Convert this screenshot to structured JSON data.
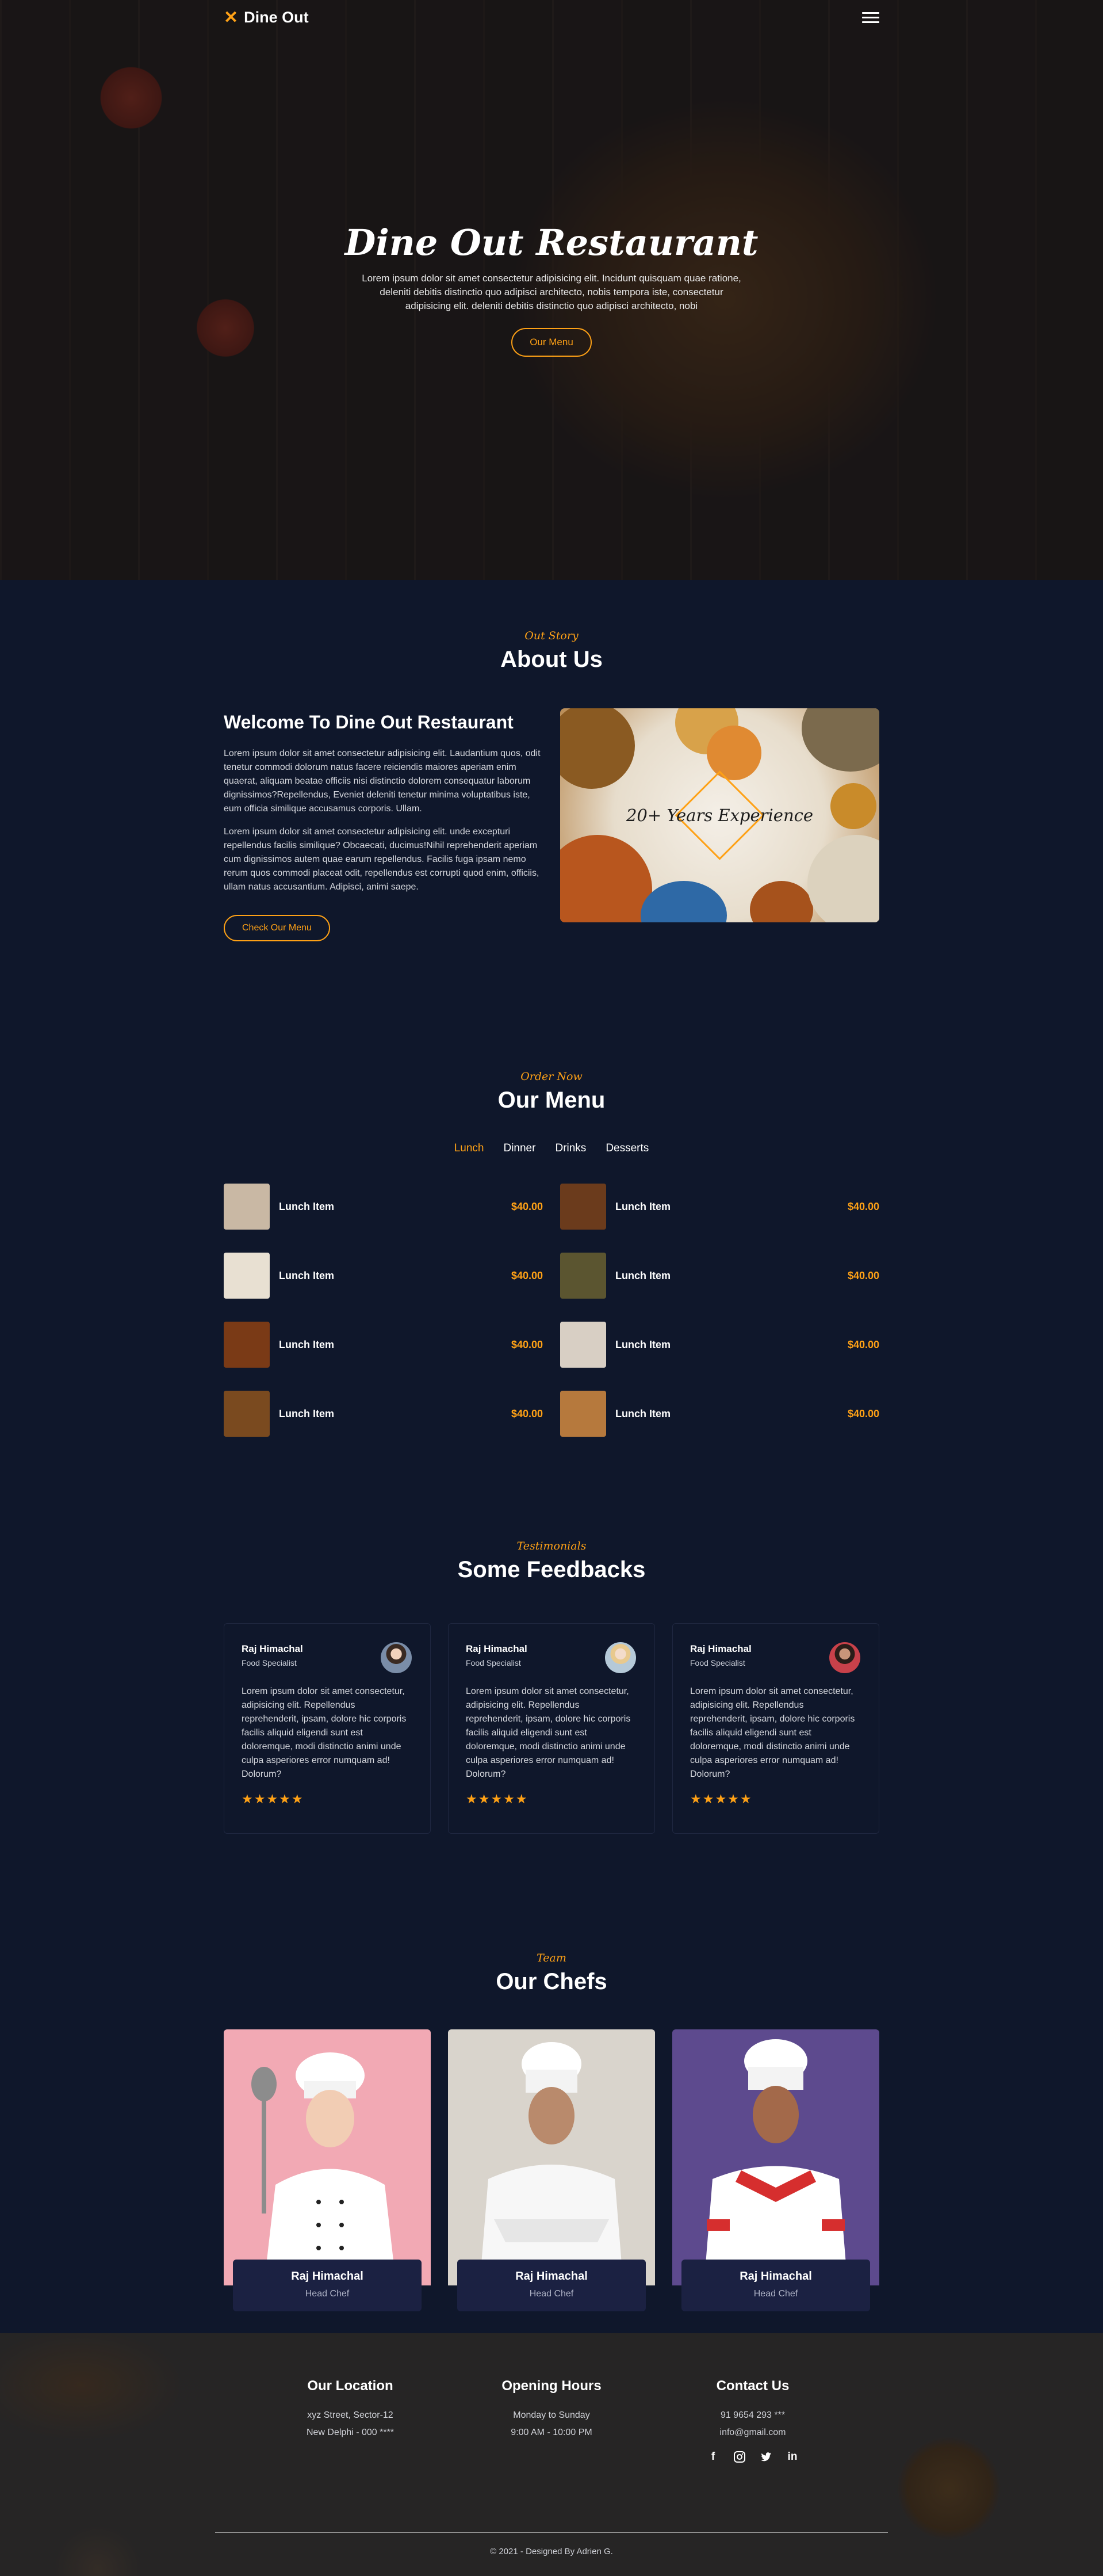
{
  "nav": {
    "brand": "Dine Out",
    "brand_icon": "utensils-icon"
  },
  "hero": {
    "title": "Dine Out Restaurant",
    "subtitle": "Lorem ipsum dolor sit amet consectetur adipisicing elit. Incidunt quisquam quae ratione, deleniti debitis distinctio quo adipisci architecto, nobis tempora iste, consectetur adipisicing elit. deleniti debitis distinctio quo adipisci architecto, nobi",
    "button": "Our Menu"
  },
  "about": {
    "label": "Out Story",
    "title": "About Us",
    "heading": "Welcome To Dine Out Restaurant",
    "para1": "Lorem ipsum dolor sit amet consectetur adipisicing elit. Laudantium quos, odit tenetur commodi dolorum natus facere reiciendis maiores aperiam enim quaerat, aliquam beatae officiis nisi distinctio dolorem consequatur laborum dignissimos?Repellendus, Eveniet deleniti tenetur minima voluptatibus iste, eum officia similique accusamus corporis. Ullam.",
    "para2": "Lorem ipsum dolor sit amet consectetur adipisicing elit. unde excepturi repellendus facilis similique? Obcaecati, ducimus!Nihil reprehenderit aperiam cum dignissimos autem quae earum repellendus. Facilis fuga ipsam nemo rerum quos commodi placeat odit, repellendus est corrupti quod enim, officiis, ullam natus accusantium. Adipisci, animi saepe.",
    "button": "Check Our Menu",
    "badge": "20+ Years Experience"
  },
  "menu": {
    "label": "Order Now",
    "title": "Our Menu",
    "tabs": [
      "Lunch",
      "Dinner",
      "Drinks",
      "Desserts"
    ],
    "active_tab": "Lunch",
    "items": [
      {
        "name": "Lunch Item",
        "price": "$40.00",
        "color": "#c9b8a4"
      },
      {
        "name": "Lunch Item",
        "price": "$40.00",
        "color": "#6b3b1c"
      },
      {
        "name": "Lunch Item",
        "price": "$40.00",
        "color": "#e8e0d2"
      },
      {
        "name": "Lunch Item",
        "price": "$40.00",
        "color": "#5b5530"
      },
      {
        "name": "Lunch Item",
        "price": "$40.00",
        "color": "#7a3a16"
      },
      {
        "name": "Lunch Item",
        "price": "$40.00",
        "color": "#d8cfc4"
      },
      {
        "name": "Lunch Item",
        "price": "$40.00",
        "color": "#7a4a1f"
      },
      {
        "name": "Lunch Item",
        "price": "$40.00",
        "color": "#b6793d"
      }
    ]
  },
  "feedback": {
    "label": "Testimonials",
    "title": "Some Feedbacks",
    "cards": [
      {
        "name": "Raj Himachal",
        "role": "Food Specialist",
        "text": "Lorem ipsum dolor sit amet consectetur, adipisicing elit. Repellendus reprehenderit, ipsam, dolore hic corporis facilis aliquid eligendi sunt est doloremque, modi distinctio animi unde culpa asperiores error numquam ad! Dolorum?",
        "stars": "★★★★★",
        "avatar_color": "#7a8da8"
      },
      {
        "name": "Raj Himachal",
        "role": "Food Specialist",
        "text": "Lorem ipsum dolor sit amet consectetur, adipisicing elit. Repellendus reprehenderit, ipsam, dolore hic corporis facilis aliquid eligendi sunt est doloremque, modi distinctio animi unde culpa asperiores error numquam ad! Dolorum?",
        "stars": "★★★★★",
        "avatar_color": "#b5c9d8"
      },
      {
        "name": "Raj Himachal",
        "role": "Food Specialist",
        "text": "Lorem ipsum dolor sit amet consectetur, adipisicing elit. Repellendus reprehenderit, ipsam, dolore hic corporis facilis aliquid eligendi sunt est doloremque, modi distinctio animi unde culpa asperiores error numquam ad! Dolorum?",
        "stars": "★★★★★",
        "avatar_color": "#c8414a"
      }
    ]
  },
  "chefs": {
    "label": "Team",
    "title": "Our Chefs",
    "items": [
      {
        "name": "Raj Himachal",
        "role": "Head Chef",
        "bg": "#f2a9b4"
      },
      {
        "name": "Raj Himachal",
        "role": "Head Chef",
        "bg": "#d9d4cc"
      },
      {
        "name": "Raj Himachal",
        "role": "Head Chef",
        "bg": "#5d4a8e"
      }
    ]
  },
  "footer": {
    "location": {
      "title": "Our Location",
      "line1": "xyz Street, Sector-12",
      "line2": "New Delphi - 000 ****"
    },
    "hours": {
      "title": "Opening Hours",
      "line1": "Monday to Sunday",
      "line2": "9:00 AM - 10:00 PM"
    },
    "contact": {
      "title": "Contact Us",
      "line1": "91 9654 293 ***",
      "line2": "info@gmail.com"
    },
    "socials": [
      "facebook-icon",
      "instagram-icon",
      "twitter-icon",
      "linkedin-icon"
    ],
    "copyright": "© 2021 - Designed By Adrien G."
  },
  "colors": {
    "accent": "#fea116",
    "background": "#0f172b",
    "card_bg": "#1b2142"
  }
}
